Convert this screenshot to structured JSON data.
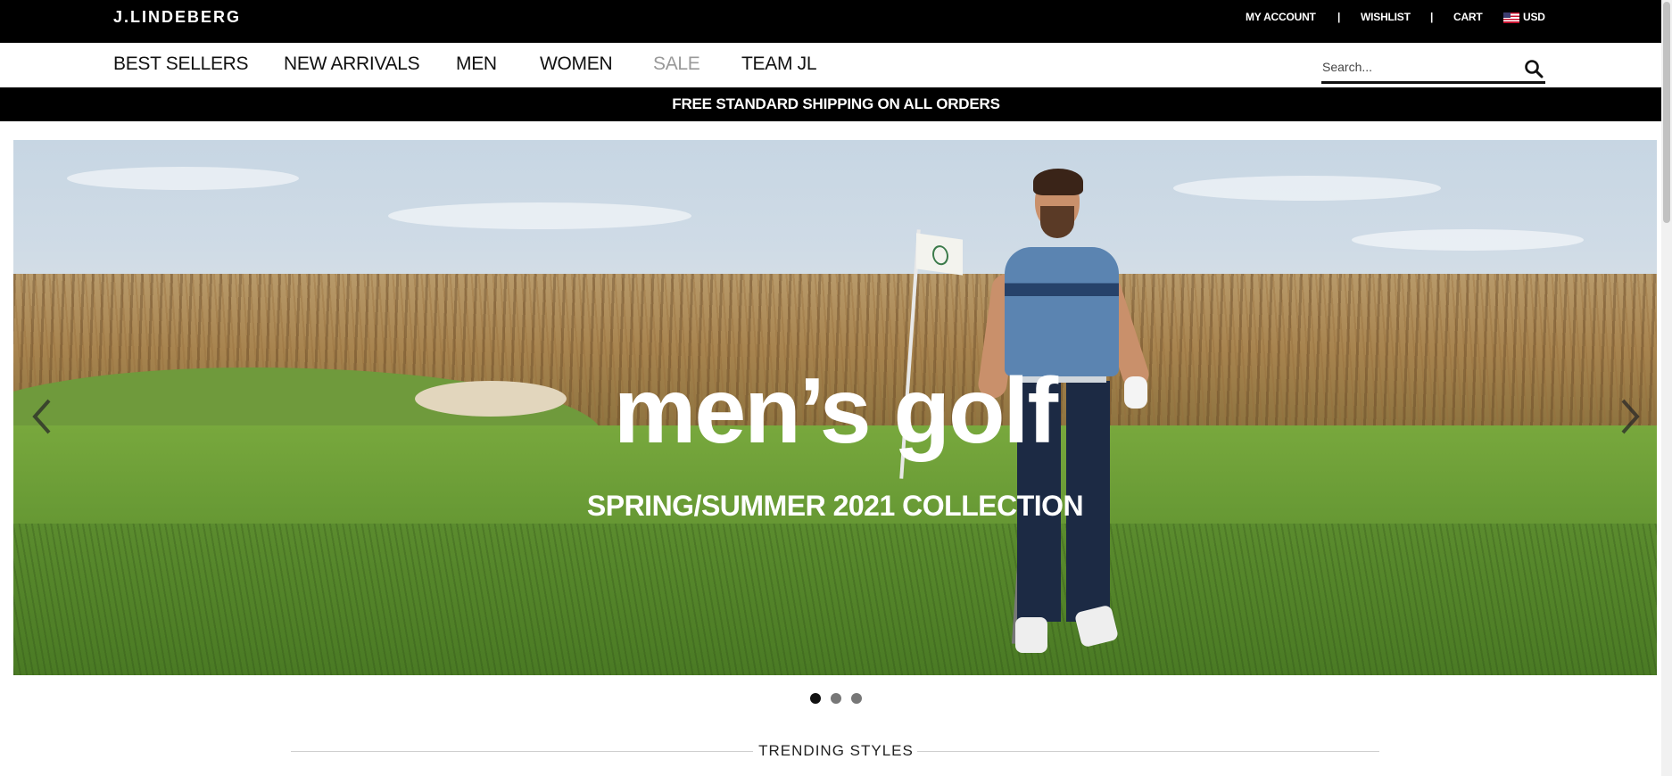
{
  "brand": {
    "logo_text": "J.LINDEBERG"
  },
  "utility_nav": {
    "my_account": "MY ACCOUNT",
    "separator": "|",
    "wishlist": "WISHLIST",
    "cart": "CART",
    "currency": "USD",
    "currency_flag_icon": "us-flag-icon"
  },
  "main_nav": {
    "items": [
      {
        "label": "BEST SELLERS"
      },
      {
        "label": "NEW ARRIVALS"
      },
      {
        "label": "MEN"
      },
      {
        "label": "WOMEN"
      },
      {
        "label": "SALE",
        "color": "#999999"
      },
      {
        "label": "TEAM JL"
      }
    ]
  },
  "search": {
    "placeholder": "Search...",
    "icon": "search-icon"
  },
  "promo_bar": {
    "text": "FREE STANDARD SHIPPING ON ALL ORDERS"
  },
  "hero": {
    "title": "men’s golf",
    "subtitle": "SPRING/SUMMER 2021 COLLECTION",
    "prev_icon": "chevron-left-icon",
    "next_icon": "chevron-right-icon",
    "slide_count": 3,
    "active_slide": 1
  },
  "trending": {
    "title": "TRENDING STYLES"
  },
  "colors": {
    "header_bg": "#000000",
    "nav_text": "#111111",
    "sale_text": "#999999",
    "dot_active": "#111111",
    "dot_inactive": "#777777"
  }
}
